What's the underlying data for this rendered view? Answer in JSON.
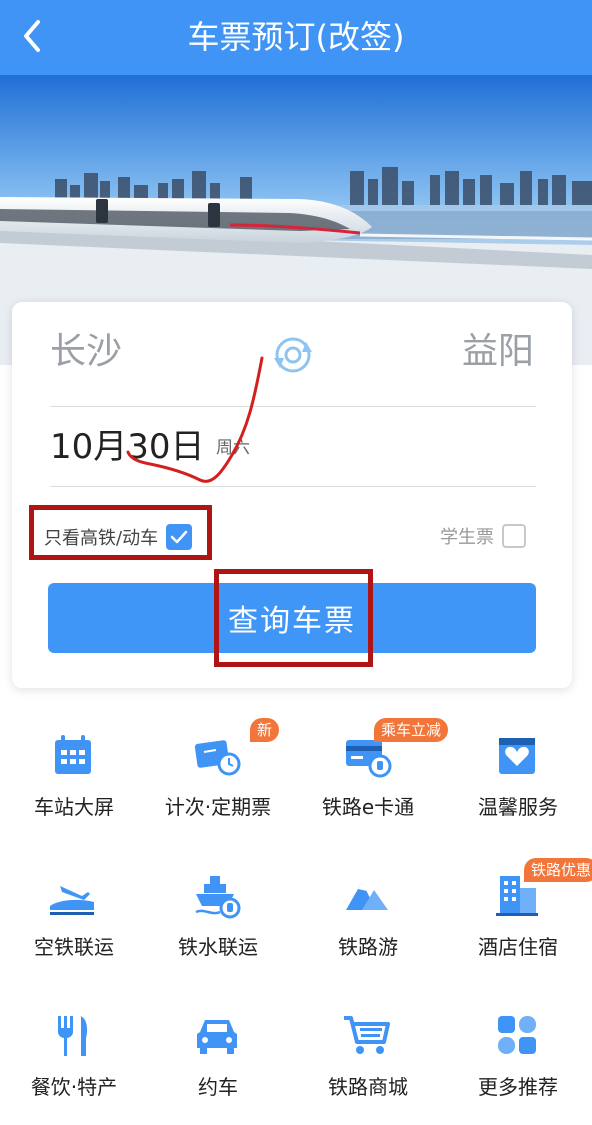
{
  "header": {
    "title": "车票预订(改签)",
    "back_icon": "chevron-left-icon"
  },
  "route": {
    "from": "长沙",
    "to": "益阳",
    "swap_icon": "swap-icon"
  },
  "date": {
    "text": "10月30日",
    "weekday": "周六"
  },
  "options": {
    "high_speed_only_label": "只看高铁/动车",
    "high_speed_only_checked": true,
    "student_label": "学生票",
    "student_checked": false
  },
  "query_button": "查询车票",
  "services": [
    {
      "label": "车站大屏",
      "icon": "calendar-grid-icon",
      "badge": ""
    },
    {
      "label": "计次·定期票",
      "icon": "ticket-clock-icon",
      "badge": "新"
    },
    {
      "label": "铁路e卡通",
      "icon": "rail-card-icon",
      "badge": "乘车立减"
    },
    {
      "label": "温馨服务",
      "icon": "heart-service-icon",
      "badge": ""
    },
    {
      "label": "空铁联运",
      "icon": "plane-train-icon",
      "badge": ""
    },
    {
      "label": "铁水联运",
      "icon": "ship-train-icon",
      "badge": ""
    },
    {
      "label": "铁路游",
      "icon": "mountain-icon",
      "badge": ""
    },
    {
      "label": "酒店住宿",
      "icon": "hotel-building-icon",
      "badge": "铁路优惠"
    },
    {
      "label": "餐饮·特产",
      "icon": "fork-knife-icon",
      "badge": ""
    },
    {
      "label": "约车",
      "icon": "car-icon",
      "badge": ""
    },
    {
      "label": "铁路商城",
      "icon": "shopping-cart-icon",
      "badge": ""
    },
    {
      "label": "更多推荐",
      "icon": "more-grid-icon",
      "badge": ""
    }
  ],
  "colors": {
    "primary": "#3f94f5",
    "badge": "#f2763a",
    "annotation": "#b01515"
  }
}
